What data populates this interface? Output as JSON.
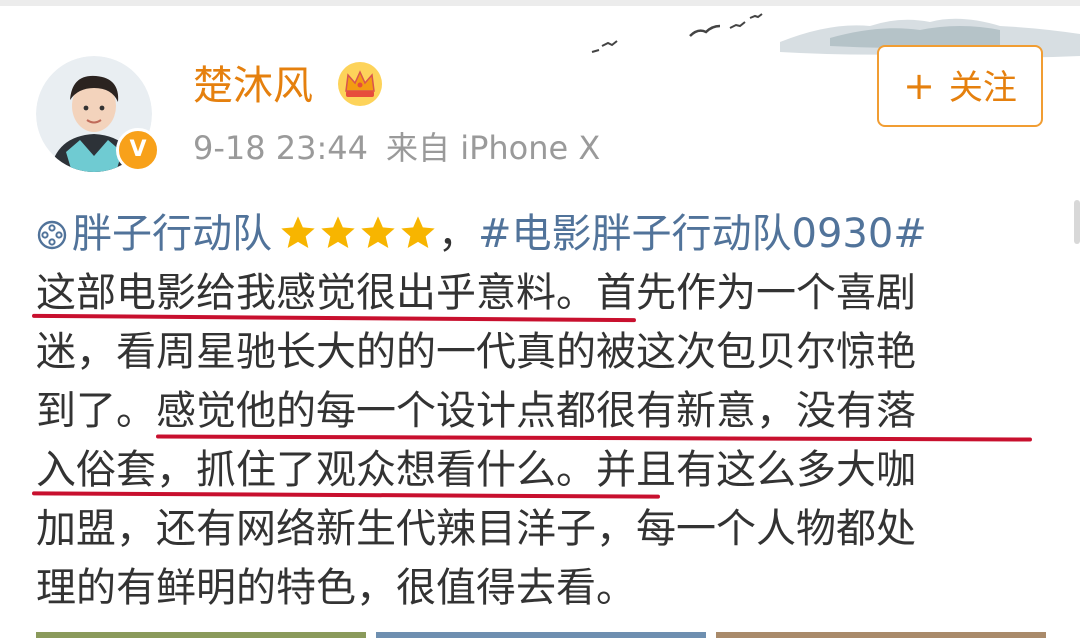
{
  "post": {
    "author": {
      "name": "楚沐风",
      "verified_badge": "V",
      "vip_crown_icon": "crown-icon"
    },
    "meta": {
      "time": "9-18 23:44",
      "source": "来自 iPhone X"
    },
    "follow_button": {
      "icon": "plus-icon",
      "label": "关注"
    },
    "content": {
      "topic_link": "胖子行动队",
      "rating_stars": 4,
      "separator": "，",
      "hashtag": "#电影胖子行动队0930#",
      "lines": [
        "这部电影给我感觉很出乎意料。首先作为一个喜剧",
        "迷，看周星驰长大的的一代真的被这次包贝尔惊艳",
        "到了。感觉他的每一个设计点都很有新意，没有落",
        "入俗套，抓住了观众想看什么。并且有这么多大咖",
        "加盟，还有网络新生代辣目洋子，每一个人物都处",
        "理的有鲜明的特色，很值得去看。"
      ]
    }
  },
  "colors": {
    "username": "#e5800e",
    "link": "#51739a",
    "meta": "#9a9a9a",
    "underline": "#c8102e",
    "follow_border": "#f19d32",
    "star": "#f7b500"
  }
}
